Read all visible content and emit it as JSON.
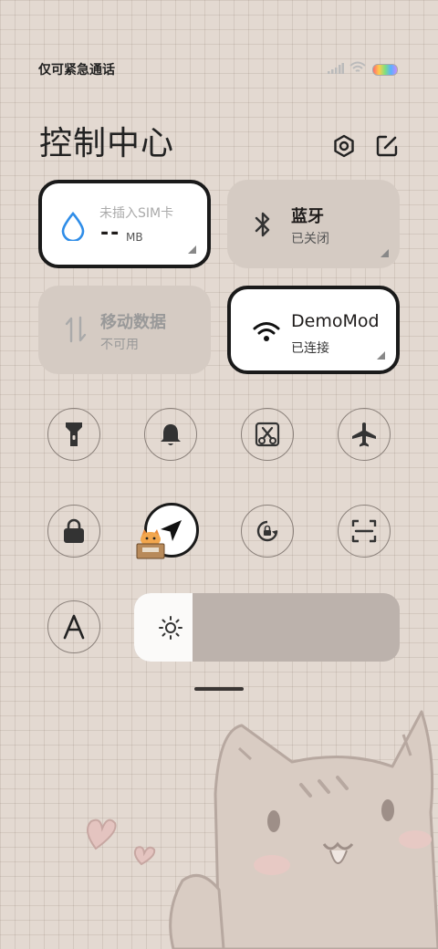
{
  "status_bar": {
    "carrier_text": "仅可紧急通话"
  },
  "header": {
    "title": "控制中心",
    "settings_icon": "settings-hexagon-icon",
    "edit_icon": "edit-icon"
  },
  "tiles": {
    "data_usage": {
      "label": "未插入SIM卡",
      "value": "--",
      "unit": "MB",
      "icon": "water-drop-icon"
    },
    "bluetooth": {
      "label": "蓝牙",
      "status": "已关闭",
      "icon": "bluetooth-icon"
    },
    "mobile_data": {
      "label": "移动数据",
      "status": "不可用",
      "icon": "data-arrows-icon"
    },
    "wifi": {
      "label": "DemoMod",
      "status": "已连接",
      "icon": "wifi-icon"
    }
  },
  "toggles": [
    {
      "name": "flashlight",
      "icon": "flashlight-icon",
      "active": false
    },
    {
      "name": "ringer",
      "icon": "bell-icon",
      "active": false
    },
    {
      "name": "screenshot",
      "icon": "screenshot-scissors-icon",
      "active": false
    },
    {
      "name": "airplane-mode",
      "icon": "airplane-icon",
      "active": false
    },
    {
      "name": "lock-screen",
      "icon": "lock-icon",
      "active": false
    },
    {
      "name": "location",
      "icon": "location-arrow-icon",
      "active": true
    },
    {
      "name": "auto-rotate",
      "icon": "rotate-lock-icon",
      "active": false
    },
    {
      "name": "scanner",
      "icon": "scan-icon",
      "active": false
    },
    {
      "name": "reading-mode",
      "icon": "font-a-icon",
      "active": false
    }
  ],
  "brightness": {
    "level_percent": 22,
    "icon": "sun-icon"
  },
  "colors": {
    "tile_active": "#ffffff",
    "tile_inactive": "#d5cbc3",
    "background": "#e3d9d1",
    "accent_drop": "#2f8de8"
  }
}
